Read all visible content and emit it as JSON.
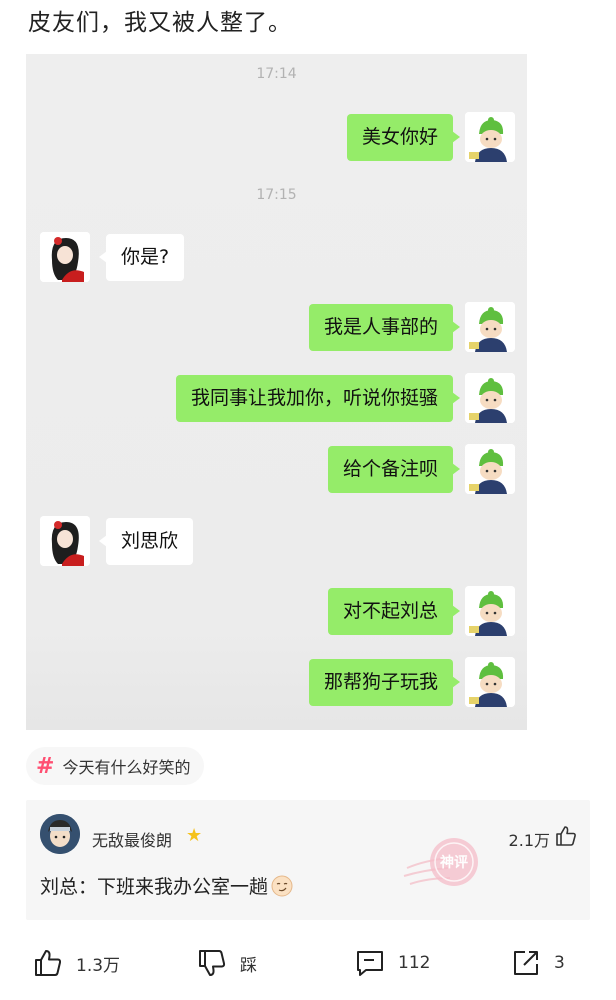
{
  "post": {
    "title": "皮友们，我又被人整了。"
  },
  "chat": {
    "timestamps": [
      "17:14",
      "17:15"
    ],
    "messages": [
      {
        "side": "out",
        "text": "美女你好"
      },
      {
        "side": "in",
        "text": "你是?"
      },
      {
        "side": "out",
        "text": "我是人事部的"
      },
      {
        "side": "out",
        "text": "我同事让我加你，听说你挺骚"
      },
      {
        "side": "out",
        "text": "给个备注呗"
      },
      {
        "side": "in",
        "text": "刘思欣"
      },
      {
        "side": "out",
        "text": "对不起刘总"
      },
      {
        "side": "out",
        "text": "那帮狗子玩我"
      }
    ]
  },
  "topic": {
    "icon": "hashtag-icon",
    "label": "今天有什么好笑的"
  },
  "top_comment": {
    "username": "无敌最俊朗",
    "badge_icon": "star-icon",
    "likes": "2.1万",
    "text": "刘总：下班来我办公室一趟",
    "emoji_icon": "smirk-emoji-icon",
    "stamp_label": "神评"
  },
  "actions": {
    "like_count": "1.3万",
    "dislike_label": "踩",
    "comment_count": "112",
    "share_count": "3"
  },
  "colors": {
    "outgoing_bubble": "#95ec69",
    "incoming_bubble": "#ffffff",
    "accent_pink": "#ff4f72"
  }
}
